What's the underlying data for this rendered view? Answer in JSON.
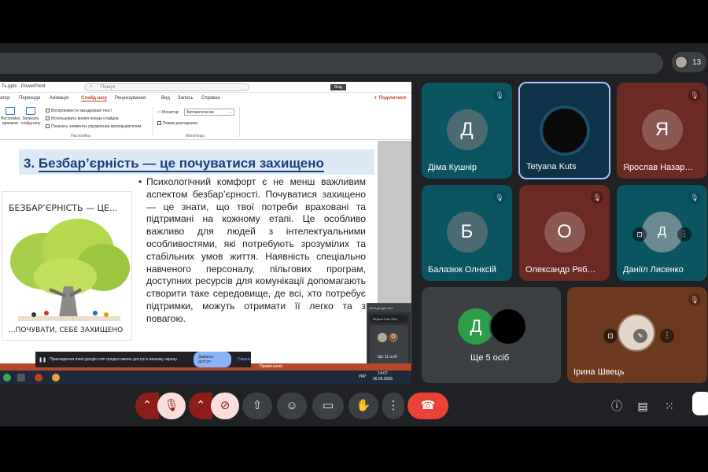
{
  "top": {
    "participants_count": "13"
  },
  "ppt": {
    "filename": "Ть.pptx · PowerPoint",
    "search_placeholder": "Пошук",
    "login": "Вхід",
    "tabs": [
      "атор",
      "Переходи",
      "Анімація",
      "Слайд-шоу",
      "Рецензування",
      "Вид",
      "Запись",
      "Справка"
    ],
    "share_label": "Поділитися",
    "ribbon": {
      "btn1": "Настройка времени",
      "btn2": "Записать слайд-шоу",
      "opt1": "Воспроизвести закадровый текст",
      "opt2": "Использовать время показа слайдов",
      "opt3": "Показать элементы управления проигрывателем",
      "group1": "Настройка",
      "monitor_label": "Монитор:",
      "monitor_value": "Автоматически",
      "presenter_view": "Режим докладчика",
      "group2": "Мониторы"
    }
  },
  "slide": {
    "title_number": "3.",
    "title_text": "Безбар’єрність — це почуватися захищено",
    "image_top_text": "БЕЗБАР’ЄРНІСТЬ — ЦЕ...",
    "image_bottom_text": "...ПОЧУВАТИ, СЕБЕ ЗАХИЩЕНО",
    "body": "Психологічний комфорт є не менш важливим аспектом безбар’єрності. Почуватися захищено — це знати, що твої потреби враховані та підтримані на кожному етапі. Це особливо важливо для людей з інтелектуальними особливостями, які потребують зрозумілих та стабільних умов життя. Наявність спеціально навченого персоналу, пільгових програм, доступних ресурсів для комунікації допомагають створити таке середовище, де всі, хто потребує підтримки, можуть отримати її легко та з повагою."
  },
  "pip": {
    "url": "meet.google.com",
    "chip": "Tetyana Kuts (Ви)",
    "tile_label": "Ще 11 осіб",
    "tile_letter": "О"
  },
  "notification": {
    "text": "Прикладення meet.google.com предоставлен доступ к вашему экрану.",
    "stop": "Закрыть доступ",
    "hide": "Скрыть"
  },
  "status": {
    "mode": "Примечания"
  },
  "taskbar": {
    "lang": "УКР",
    "time": "14:07",
    "date": "26.05.2026"
  },
  "tiles": [
    {
      "letter": "Д",
      "name": "Діма Кушнір",
      "mute": "blue",
      "bg": "#0b5563"
    },
    {
      "letter": "",
      "name": "Tetyana Kuts",
      "mute": "",
      "bg": "#0d3348"
    },
    {
      "letter": "Я",
      "name": "Ярослав Назар…",
      "mute": "red",
      "bg": "#6b2a22"
    },
    {
      "letter": "Б",
      "name": "Балазюк Олнксій",
      "mute": "blue",
      "bg": "#0b5563"
    },
    {
      "letter": "О",
      "name": "Олександр Ряб…",
      "mute": "red",
      "bg": "#6b2a22"
    },
    {
      "letter": "Д",
      "name": "Даніїл Лисенко",
      "mute": "blue",
      "bg": "#0b5563"
    },
    {
      "letter": "Д",
      "name": "Ще 5 осіб",
      "mute": "",
      "bg": "#3c4043"
    },
    {
      "letter": "",
      "name": "Ірина Швець",
      "mute": "red",
      "bg": "#6b3a1e"
    }
  ],
  "colors": {
    "accent": "#8ab4f8",
    "hangup": "#ea4335",
    "muted_bg": "#8c1d18"
  }
}
